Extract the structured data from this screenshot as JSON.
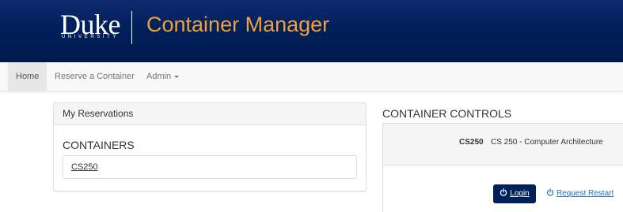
{
  "header": {
    "logo_wordmark": "Duke",
    "logo_subtext": "UNIVERSITY",
    "app_title": "Container Manager",
    "colors": {
      "header_bg": "#00205b",
      "title": "#f0a03a"
    }
  },
  "nav": {
    "items": [
      {
        "label": "Home",
        "active": true
      },
      {
        "label": "Reserve a Container",
        "active": false
      },
      {
        "label": "Admin",
        "active": false,
        "dropdown": true
      }
    ]
  },
  "reservations": {
    "heading": "My Reservations",
    "section_title": "CONTAINERS",
    "containers": [
      "CS250"
    ]
  },
  "controls": {
    "title": "CONTAINER CONTROLS",
    "course_code": "CS250",
    "course_name": "CS 250 - Computer Architecture",
    "login_label": "Login",
    "restart_label": "Request Restart",
    "login_icon": "power-icon",
    "restart_icon": "power-icon"
  }
}
